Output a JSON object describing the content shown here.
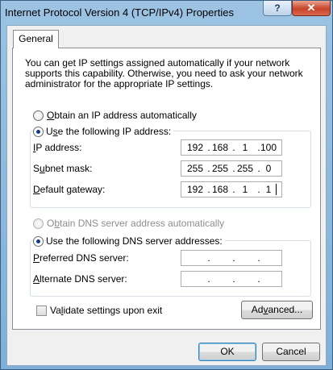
{
  "window": {
    "title": "Internet Protocol Version 4 (TCP/IPv4) Properties",
    "help_label": "?",
    "close_label": "✕"
  },
  "tabs": [
    {
      "label": "General",
      "selected": true
    }
  ],
  "intro": "You can get IP settings assigned automatically if your network supports this capability. Otherwise, you need to ask your network administrator for the appropriate IP settings.",
  "ip_mode": {
    "auto_label": "Obtain an IP address automatically",
    "manual_label": "Use the following IP address:",
    "selected": "manual"
  },
  "ip_fields": [
    {
      "label": "IP address:",
      "accel": "I",
      "octets": [
        "192",
        "168",
        "1",
        "100"
      ]
    },
    {
      "label": "Subnet mask:",
      "accel": "u",
      "octets": [
        "255",
        "255",
        "255",
        "0"
      ]
    },
    {
      "label": "Default gateway:",
      "accel": "D",
      "octets": [
        "192",
        "168",
        "1",
        "1"
      ]
    }
  ],
  "dns_mode": {
    "auto_label": "Obtain DNS server address automatically",
    "manual_label": "Use the following DNS server addresses:",
    "selected": "manual",
    "auto_disabled": true
  },
  "dns_fields": [
    {
      "label": "Preferred DNS server:",
      "accel": "P",
      "octets": [
        "",
        "",
        "",
        ""
      ]
    },
    {
      "label": "Alternate DNS server:",
      "accel": "A",
      "octets": [
        "",
        "",
        "",
        ""
      ]
    }
  ],
  "validate": {
    "label": "Validate settings upon exit",
    "checked": false
  },
  "buttons": {
    "advanced": "Advanced...",
    "ok": "OK",
    "cancel": "Cancel"
  },
  "dot_char": "."
}
